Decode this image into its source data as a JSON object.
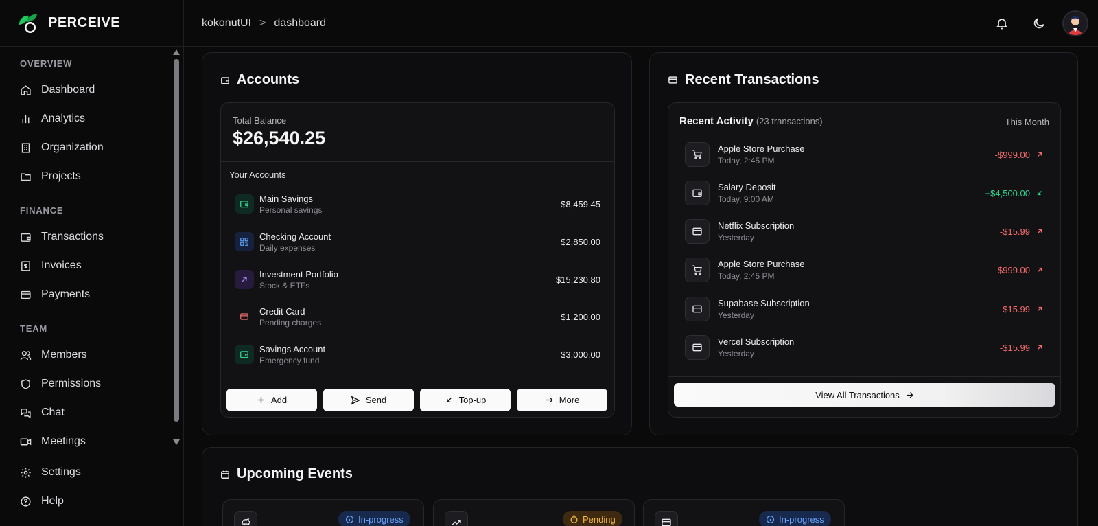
{
  "brand": {
    "name": "PERCEIVE"
  },
  "breadcrumb": {
    "root": "kokonutUI",
    "separator": ">",
    "current": "dashboard"
  },
  "sidebar": {
    "overview_title": "OVERVIEW",
    "overview": [
      {
        "label": "Dashboard",
        "icon": "home-icon"
      },
      {
        "label": "Analytics",
        "icon": "bar-chart-icon"
      },
      {
        "label": "Organization",
        "icon": "building-icon"
      },
      {
        "label": "Projects",
        "icon": "folder-icon"
      }
    ],
    "finance_title": "FINANCE",
    "finance": [
      {
        "label": "Transactions",
        "icon": "wallet-icon"
      },
      {
        "label": "Invoices",
        "icon": "receipt-icon"
      },
      {
        "label": "Payments",
        "icon": "credit-card-icon"
      }
    ],
    "team_title": "TEAM",
    "team": [
      {
        "label": "Members",
        "icon": "users-icon"
      },
      {
        "label": "Permissions",
        "icon": "shield-icon"
      },
      {
        "label": "Chat",
        "icon": "chat-icon"
      },
      {
        "label": "Meetings",
        "icon": "video-icon"
      }
    ],
    "bottom": [
      {
        "label": "Settings",
        "icon": "gear-icon"
      },
      {
        "label": "Help",
        "icon": "help-icon"
      }
    ]
  },
  "accounts": {
    "title": "Accounts",
    "total_label": "Total Balance",
    "total_value": "$26,540.25",
    "your_accounts": "Your Accounts",
    "items": [
      {
        "name": "Main Savings",
        "sub": "Personal savings",
        "amount": "$8,459.45",
        "icon": "wallet-icon",
        "color": "#34d399"
      },
      {
        "name": "Checking Account",
        "sub": "Daily expenses",
        "amount": "$2,850.00",
        "icon": "qr-code-icon",
        "color": "#60a5fa"
      },
      {
        "name": "Investment Portfolio",
        "sub": "Stock & ETFs",
        "amount": "$15,230.80",
        "icon": "arrow-up-right-icon",
        "color": "#a78bfa"
      },
      {
        "name": "Credit Card",
        "sub": "Pending charges",
        "amount": "$1,200.00",
        "icon": "credit-card-icon",
        "color": "#f87171"
      },
      {
        "name": "Savings Account",
        "sub": "Emergency fund",
        "amount": "$3,000.00",
        "icon": "wallet-icon",
        "color": "#34d399"
      }
    ],
    "buttons": {
      "add": "Add",
      "send": "Send",
      "topup": "Top-up",
      "more": "More"
    }
  },
  "recent": {
    "title": "Recent Transactions",
    "activity_title": "Recent Activity",
    "activity_count": "(23 transactions)",
    "period": "This Month",
    "items": [
      {
        "name": "Apple Store Purchase",
        "time": "Today, 2:45 PM",
        "amount": "-$999.00",
        "icon": "cart-icon",
        "direction": "out"
      },
      {
        "name": "Salary Deposit",
        "time": "Today, 9:00 AM",
        "amount": "+$4,500.00",
        "icon": "wallet-icon",
        "direction": "in"
      },
      {
        "name": "Netflix Subscription",
        "time": "Yesterday",
        "amount": "-$15.99",
        "icon": "credit-card-icon",
        "direction": "out"
      },
      {
        "name": "Apple Store Purchase",
        "time": "Today, 2:45 PM",
        "amount": "-$999.00",
        "icon": "cart-icon",
        "direction": "out"
      },
      {
        "name": "Supabase Subscription",
        "time": "Yesterday",
        "amount": "-$15.99",
        "icon": "credit-card-icon",
        "direction": "out"
      },
      {
        "name": "Vercel Subscription",
        "time": "Yesterday",
        "amount": "-$15.99",
        "icon": "credit-card-icon",
        "direction": "out"
      }
    ],
    "view_all": "View All Transactions"
  },
  "events": {
    "title": "Upcoming Events",
    "items": [
      {
        "status": "In-progress",
        "icon": "piggy-bank-icon"
      },
      {
        "status": "Pending",
        "icon": "trending-up-icon"
      },
      {
        "status": "In-progress",
        "icon": "credit-card-icon"
      }
    ]
  },
  "colors": {
    "negative": "#f06a6a",
    "positive": "#35d08a",
    "badge_blue": "#6aa4ff",
    "badge_amber": "#f5b642"
  }
}
